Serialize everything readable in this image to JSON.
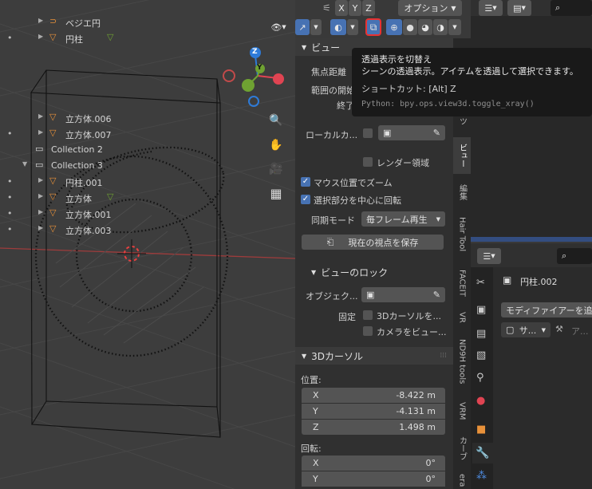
{
  "header": {
    "axes_buttons": [
      "X",
      "Y",
      "Z"
    ],
    "options_label": "オプション"
  },
  "tooltip": {
    "title": "透過表示を切替え",
    "description": "シーンの透過表示。アイテムを透過して選択できます。",
    "shortcut": "ショートカット: [Alt] Z",
    "python": "Python: bpy.ops.view3d.toggle_xray()"
  },
  "gizmo": {
    "z": "Z",
    "y": "Y"
  },
  "sidebar": {
    "view_panel": "ビュー",
    "focal_length_label": "焦点距離",
    "clip_start_label": "範囲の開始",
    "clip_end_label": "終了",
    "local_camera_label": "ローカルカ...",
    "render_region_label": "レンダー領域",
    "zoom_to_mouse_label": "マウス位置でズーム",
    "rotate_around_selection_label": "選択部分を中心に回転",
    "sync_mode_label": "同期モード",
    "sync_mode_value": "毎フレーム再生",
    "save_view_label": "現在の視点を保存",
    "view_lock_panel": "ビューのロック",
    "lock_object_label": "オブジェク...",
    "lock_label": "固定",
    "lock_3d_cursor_label": "3Dカーソルを...",
    "camera_to_view_label": "カメラをビュー...",
    "cursor_panel": "3Dカーソル",
    "location_label": "位置:",
    "loc_x": {
      "axis": "X",
      "value": "-8.422 m"
    },
    "loc_y": {
      "axis": "Y",
      "value": "-4.131 m"
    },
    "loc_z": {
      "axis": "Z",
      "value": "1.498 m"
    },
    "rotation_label": "回転:",
    "rot_x": {
      "axis": "X",
      "value": "0°"
    },
    "rot_y": {
      "axis": "Y",
      "value": "0°"
    }
  },
  "tabs": {
    "tab1": "ツ",
    "tab2": "ビュー",
    "tab3": "編集",
    "tab4": "Hair Tool",
    "tab5": "FACEIT",
    "tab6": "VR",
    "tab7": "ND9H tools",
    "tab8": "VRM",
    "tab9": "カーブ",
    "tab10": "era"
  },
  "outliner": {
    "rows": [
      {
        "name": "ベジエ円",
        "icon": "curve-icon"
      },
      {
        "name": "円柱",
        "icon": "mesh-icon"
      },
      {
        "name": "立方体.006",
        "icon": "mesh-icon"
      },
      {
        "name": "立方体.007",
        "icon": "mesh-icon"
      },
      {
        "name": "Collection 2",
        "icon": "collection-icon"
      },
      {
        "name": "Collection 3",
        "icon": "collection-icon"
      },
      {
        "name": "円柱.001",
        "icon": "mesh-icon"
      },
      {
        "name": "立方体",
        "icon": "mesh-icon"
      },
      {
        "name": "立方体.001",
        "icon": "mesh-icon"
      },
      {
        "name": "立方体.003",
        "icon": "mesh-icon"
      }
    ]
  },
  "properties": {
    "object_name": "円柱.002",
    "add_modifier_label": "モディファイアーを追",
    "sub_label": "サ...",
    "sub_label2": "ア..."
  },
  "colors": {
    "accent": "#4772b3",
    "x_axis": "#e04452",
    "y_axis": "#6fa232",
    "z_axis": "#2e7bd8",
    "highlight_red": "#e83232"
  }
}
